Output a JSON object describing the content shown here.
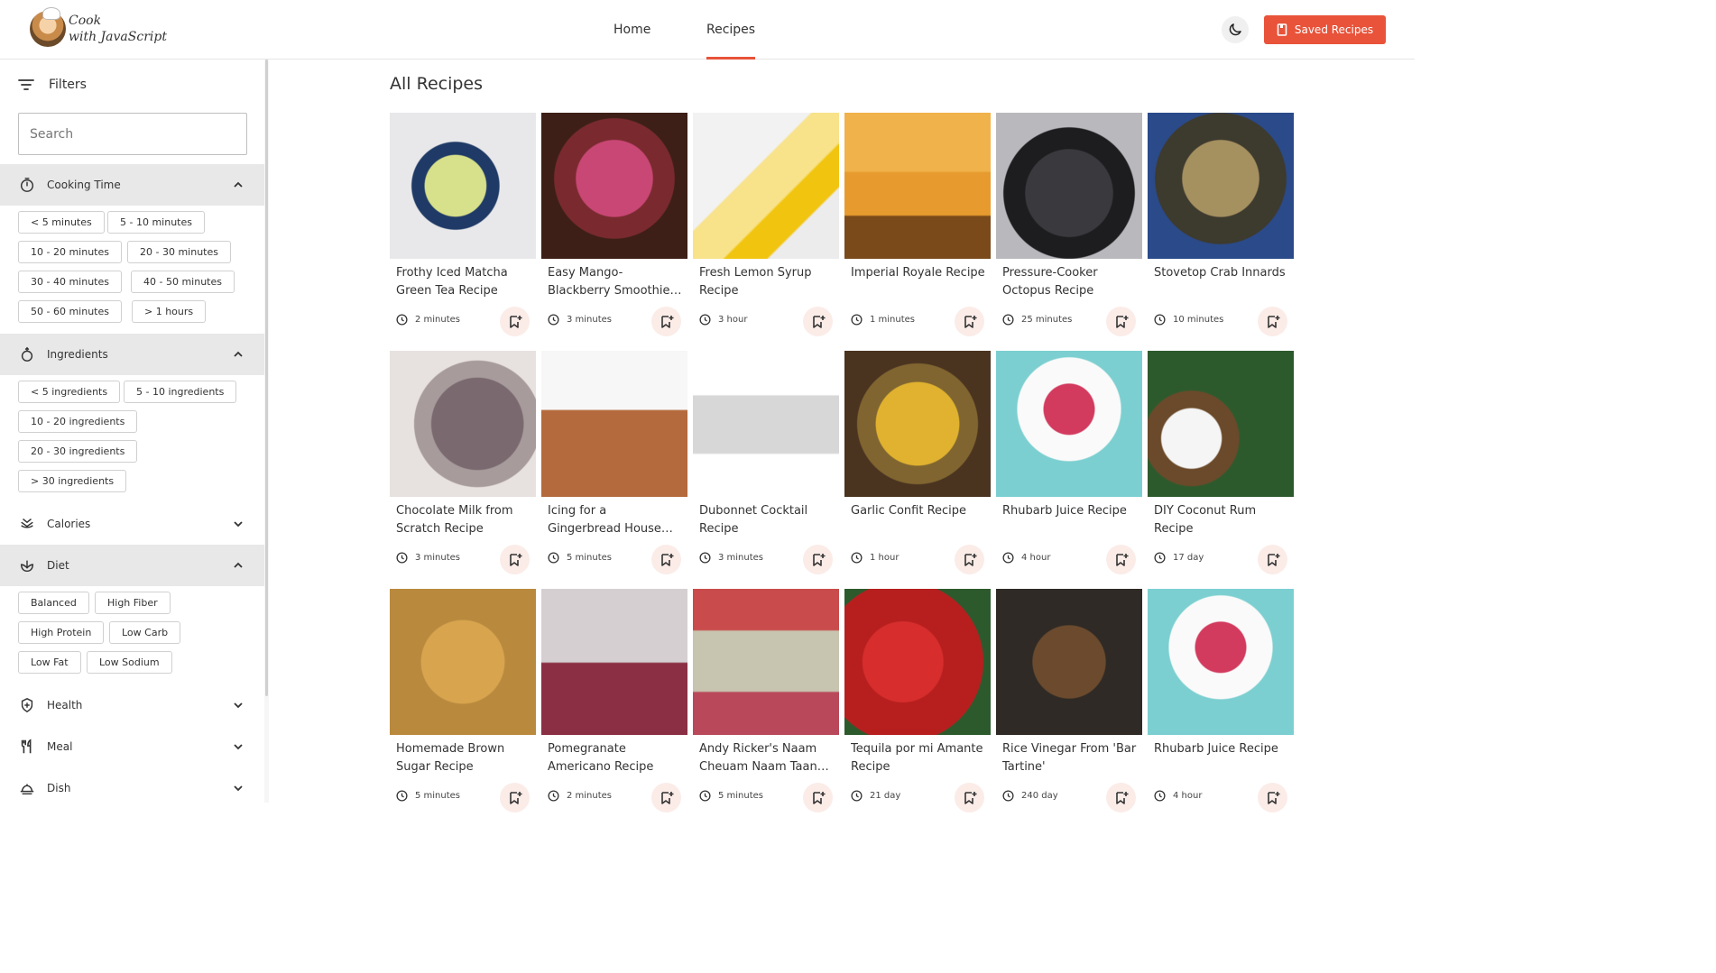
{
  "header": {
    "logo_line1": "Cook",
    "logo_line2": "with JavaScript",
    "nav_home": "Home",
    "nav_recipes": "Recipes",
    "saved_label": "Saved Recipes",
    "accent_color": "#e8533a"
  },
  "sidebar": {
    "filters_label": "Filters",
    "search_placeholder": "Search",
    "sections": {
      "cooking_time": {
        "label": "Cooking Time",
        "expanded": true,
        "chips": [
          "< 5 minutes",
          "5 - 10 minutes",
          "10 - 20 minutes",
          "20 - 30 minutes",
          "30 - 40 minutes",
          "40 - 50 minutes",
          "50 - 60 minutes",
          "> 1 hours"
        ]
      },
      "ingredients": {
        "label": "Ingredients",
        "expanded": true,
        "chips": [
          "< 5 ingredients",
          "5 - 10 ingredients",
          "10 - 20 ingredients",
          "20 - 30 ingredients",
          "> 30 ingredients"
        ]
      },
      "calories": {
        "label": "Calories",
        "expanded": false
      },
      "diet": {
        "label": "Diet",
        "expanded": true,
        "chips": [
          "Balanced",
          "High Fiber",
          "High Protein",
          "Low Carb",
          "Low Fat",
          "Low Sodium"
        ]
      },
      "health": {
        "label": "Health",
        "expanded": false
      },
      "meal": {
        "label": "Meal",
        "expanded": false
      },
      "dish": {
        "label": "Dish",
        "expanded": false
      }
    }
  },
  "main": {
    "title": "All Recipes",
    "recipes": [
      {
        "title": "Frothy Iced Matcha Green Tea Recipe",
        "time": "2 minutes"
      },
      {
        "title": "Easy Mango-Blackberry Smoothie…",
        "time": "3 minutes"
      },
      {
        "title": "Fresh Lemon Syrup Recipe",
        "time": "3 hour"
      },
      {
        "title": "Imperial Royale Recipe",
        "time": "1 minutes"
      },
      {
        "title": "Pressure-Cooker Octopus Recipe",
        "time": "25 minutes"
      },
      {
        "title": "Stovetop Crab Innards",
        "time": "10 minutes"
      },
      {
        "title": "Chocolate Milk from Scratch Recipe",
        "time": "3 minutes"
      },
      {
        "title": "Icing for a Gingerbread House Recipe",
        "time": "5 minutes"
      },
      {
        "title": "Dubonnet Cocktail Recipe",
        "time": "3 minutes"
      },
      {
        "title": "Garlic Confit Recipe",
        "time": "1 hour"
      },
      {
        "title": "Rhubarb Juice Recipe",
        "time": "4 hour"
      },
      {
        "title": "DIY Coconut Rum Recipe",
        "time": "17 day"
      },
      {
        "title": "Homemade Brown Sugar Recipe",
        "time": "5 minutes"
      },
      {
        "title": "Pomegranate Americano Recipe",
        "time": "2 minutes"
      },
      {
        "title": "Andy Ricker's Naam Cheuam Naam Taan…",
        "time": "5 minutes"
      },
      {
        "title": "Tequila por mi Amante Recipe",
        "time": "21 day"
      },
      {
        "title": "Rice Vinegar From 'Bar Tartine'",
        "time": "240 day"
      },
      {
        "title": "Rhubarb Juice Recipe",
        "time": "4 hour"
      }
    ]
  }
}
